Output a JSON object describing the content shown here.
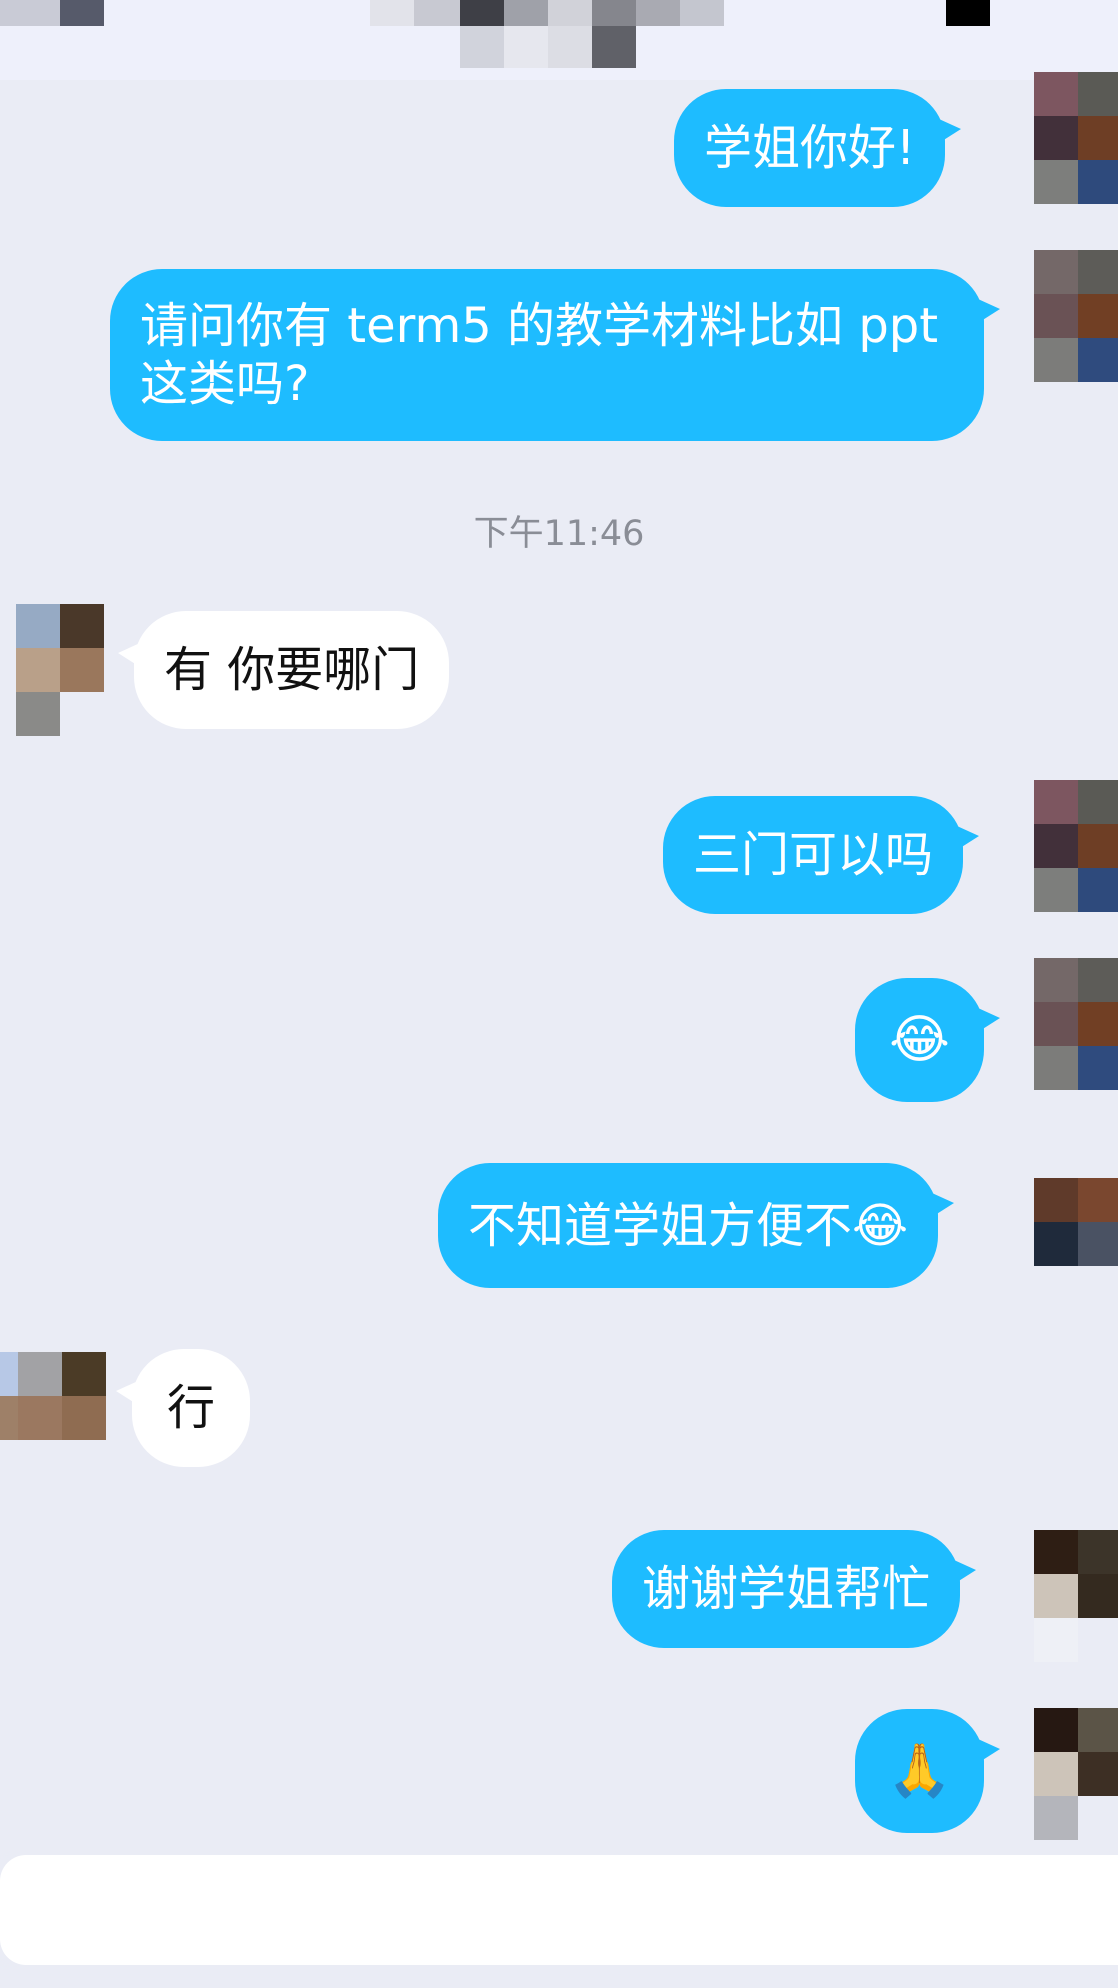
{
  "timestamp": "下午11:46",
  "messages": [
    {
      "side": "out",
      "text": "学姐你好!"
    },
    {
      "side": "out",
      "text_line1": "请问你有 term5 的教学材料比如 ppt",
      "text_line2": "这类吗?"
    },
    {
      "side": "in",
      "text": "有 你要哪门"
    },
    {
      "side": "out",
      "text": "三门可以吗"
    },
    {
      "side": "out",
      "text": "😂"
    },
    {
      "side": "out",
      "text": "不知道学姐方便不😂"
    },
    {
      "side": "in",
      "text": "行"
    },
    {
      "side": "out",
      "text": "谢谢学姐帮忙"
    },
    {
      "side": "out",
      "text": "🙏"
    }
  ],
  "colors": {
    "outgoing_bubble": "#1ebcff",
    "incoming_bubble": "#ffffff",
    "background": "#eaecf5"
  }
}
